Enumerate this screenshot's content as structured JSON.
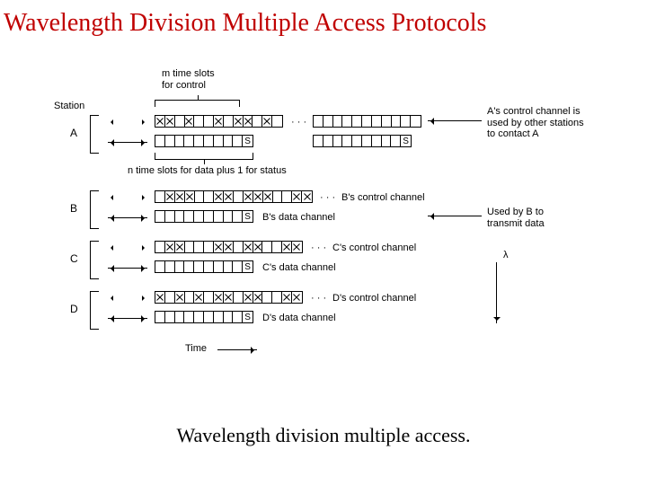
{
  "title": "Wavelength Division Multiple Access Protocols",
  "caption": "Wavelength division multiple access.",
  "labels": {
    "station": "Station",
    "m_slots": "m time slots\nfor control",
    "n_slots": "n time slots for data plus 1 for status",
    "a_note": "A's control channel is\nused by other stations\nto contact A",
    "b_note": "Used by B to\ntransmit data",
    "b_ctrl": "B's control channel",
    "b_data": "B's data channel",
    "c_ctrl": "C's control channel",
    "c_data": "C's data channel",
    "d_ctrl": "D's control channel",
    "d_data": "D's data channel",
    "time": "Time",
    "lambda": "λ",
    "dots": "· · ·",
    "s": "S"
  },
  "stations": {
    "a": "A",
    "b": "B",
    "c": "C",
    "d": "D"
  },
  "slot_patterns": {
    "a_ctrl_1": "xx.x..x.xx.x.",
    "a_data_1": ".........S",
    "a_ctrl_2": "...........",
    "a_data_2": ".........S",
    "b_ctrl": ".xxx..xx.xxx..xx",
    "b_data": ".........S",
    "c_ctrl": ".xx...xx.xx..xx",
    "c_data": ".........S",
    "d_ctrl": "x.x.x.xx.xx..xx",
    "d_data": ".........S"
  }
}
